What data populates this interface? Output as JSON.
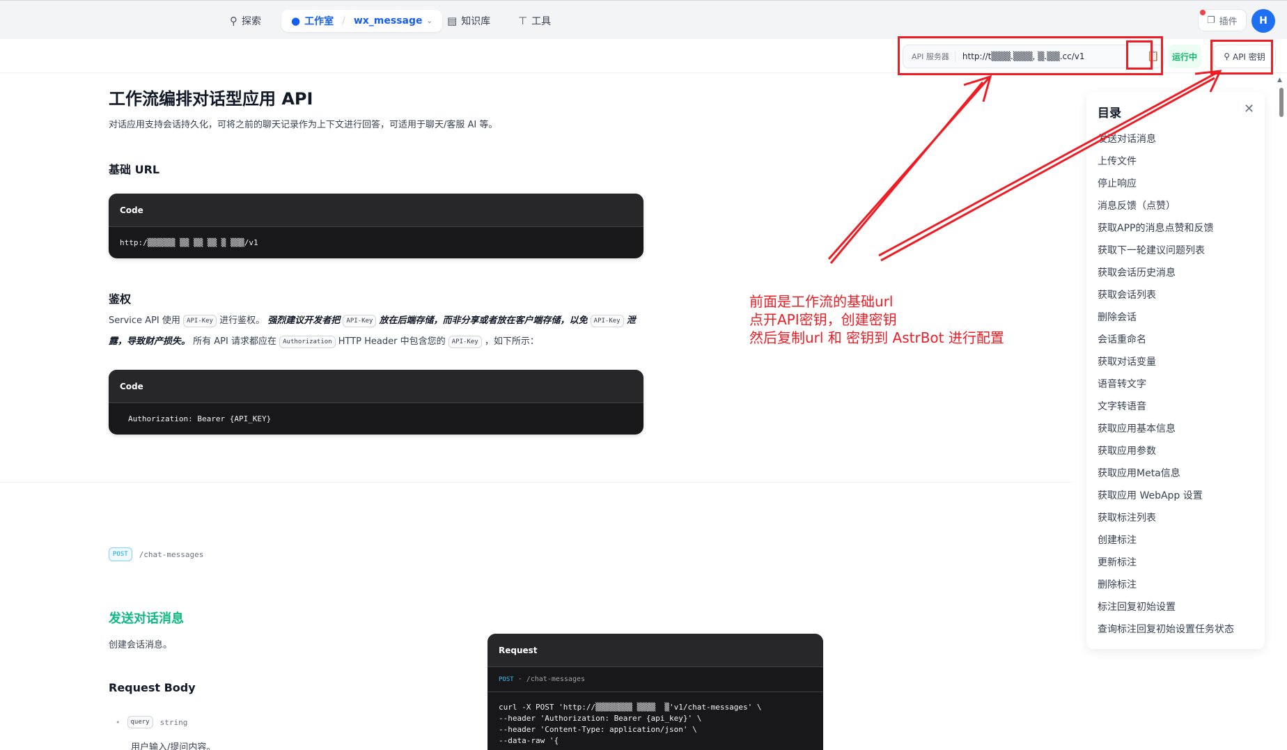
{
  "nav": {
    "explore": "探索",
    "studio": "工作室",
    "app_name": "wx_message",
    "knowledge": "知识库",
    "tools": "工具",
    "plugin": "插件",
    "avatar_letter": "H"
  },
  "toolbar": {
    "api_server_label": "API 服务器",
    "api_server_url": "http://t▒▒▒.▒▒▒, ▒.▒▒.cc/v1",
    "status": "运行中",
    "api_key_button": "API 密钥"
  },
  "doc": {
    "title": "工作流编排对话型应用 API",
    "desc": "对话应用支持会话持久化，可将之前的聊天记录作为上下文进行回答，可适用于聊天/客服 AI 等。",
    "base_url_heading": "基础 URL",
    "code_label": "Code",
    "base_url_code": "http:/▒▒▒▒▒▒ ▒▒ ▒▒ ▒▒ ▒ ▒▒▒/v1",
    "auth_heading": "鉴权",
    "auth_p1": "Service API 使用",
    "auth_chip1": "API-Key",
    "auth_p2": "进行鉴权。",
    "auth_strong1": "强烈建议开发者把",
    "auth_chip2": "API-Key",
    "auth_strong2": "放在后端存储，而非分享或者放在客户端存储，以免",
    "auth_chip3": "API-Key",
    "auth_strong3": "泄露，导致财产损失。",
    "auth_p3": "所有 API 请求都应在",
    "auth_chip4": "Authorization",
    "auth_p4": "HTTP Header 中包含您的",
    "auth_chip5": "API-Key",
    "auth_p5": "，如下所示：",
    "auth_code": "Authorization: Bearer {API_KEY}",
    "post_method": "POST",
    "post_path": "/chat-messages",
    "send_title": "发送对话消息",
    "send_desc": "创建会话消息。",
    "request_body": "Request Body",
    "param_name": "query",
    "param_type": "string",
    "param_desc": "用户输入/提问内容。"
  },
  "request": {
    "title": "Request",
    "method": "POST",
    "dot": "·",
    "path": "/chat-messages",
    "lines": [
      "curl -X POST 'http://▒▒▒▒▒▒▒▒ ▒▒▒▒  ▒'v1/chat-messages' \\",
      "--header 'Authorization: Bearer {api_key}' \\",
      "--header 'Content-Type: application/json' \\",
      "--data-raw '{"
    ]
  },
  "toc": {
    "title": "目录",
    "items": [
      "发送对话消息",
      "上传文件",
      "停止响应",
      "消息反馈（点赞）",
      "获取APP的消息点赞和反馈",
      "获取下一轮建议问题列表",
      "获取会话历史消息",
      "获取会话列表",
      "删除会话",
      "会话重命名",
      "获取对话变量",
      "语音转文字",
      "文字转语音",
      "获取应用基本信息",
      "获取应用参数",
      "获取应用Meta信息",
      "获取应用 WebApp 设置",
      "获取标注列表",
      "创建标注",
      "更新标注",
      "删除标注",
      "标注回复初始设置",
      "查询标注回复初始设置任务状态"
    ]
  },
  "annotation": {
    "line1": "前面是工作流的基础url",
    "line2": "点开API密钥，创建密钥",
    "line3": "然后复制url 和 密钥到 AstrBot 进行配置",
    "color": "#ef1c24"
  },
  "icons": {
    "explore": "compass-icon",
    "studio": "robot-icon",
    "knowledge": "book-icon",
    "tools": "tool-icon",
    "plugin": "cube-icon",
    "copy": "clipboard-icon",
    "key": "key-icon",
    "close": "close-icon"
  }
}
